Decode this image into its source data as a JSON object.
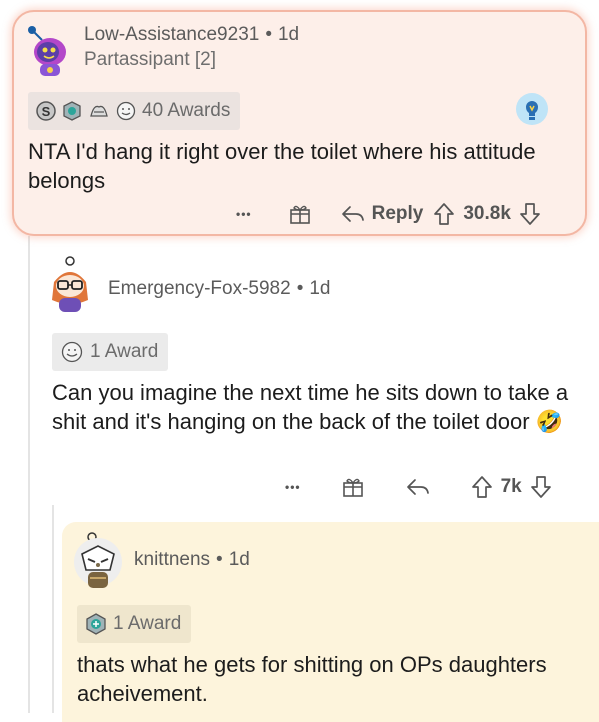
{
  "comments": [
    {
      "username": "Low-Assistance9231",
      "age": "1d",
      "flair": "Partassipant [2]",
      "awards_label": "40 Awards",
      "body": "NTA I'd hang it right over the toilet where his attitude belongs",
      "more": "•••",
      "reply_label": "Reply",
      "score": "30.8k"
    },
    {
      "username": "Emergency-Fox-5982",
      "age": "1d",
      "awards_label": "1 Award",
      "body": "Can you imagine the next time he sits down to take a shit and it's hanging on the back of the toilet door",
      "emoji": "🤣",
      "more": "•••",
      "score": "7k"
    },
    {
      "username": "knittnens",
      "age": "1d",
      "awards_label": "1 Award",
      "body": "thats what he gets for shitting on OPs daughters acheivement."
    }
  ],
  "separator": "•",
  "colors": {
    "highlight_bg": "#fdefe9",
    "highlight_border": "#f3b7a4",
    "reply_bg": "#fdf4dc",
    "text": "#1c1c1c",
    "meta": "#5b5b5b"
  }
}
